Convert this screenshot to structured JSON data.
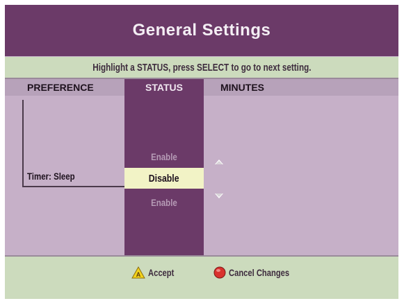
{
  "header": {
    "title": "General Settings"
  },
  "instruction": "Highlight a STATUS, press SELECT to go to next setting.",
  "columns": {
    "preference": "PREFERENCE",
    "status": "STATUS",
    "minutes": "MINUTES"
  },
  "row": {
    "preference_label": "Timer: Sleep",
    "status_options": {
      "above": "Enable",
      "selected": "Disable",
      "below": "Enable"
    }
  },
  "footer": {
    "accept_label": "Accept",
    "accept_icon": "yellow-triangle-a-icon",
    "cancel_label": "Cancel Changes",
    "cancel_icon": "red-circle-icon"
  },
  "colors": {
    "title_bar": "#6b3a68",
    "panel": "#c6b0c8",
    "instruction_bar": "#ccdbbd",
    "selection": "#f2f3c6"
  }
}
